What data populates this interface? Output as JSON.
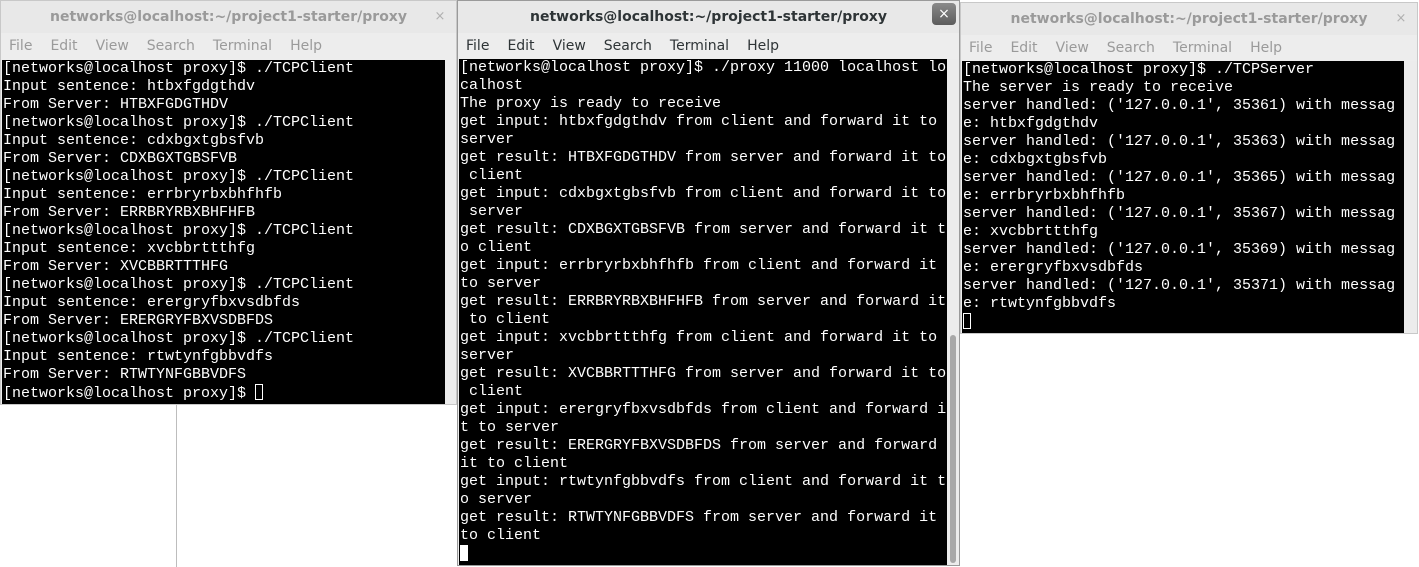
{
  "windows": {
    "client": {
      "title": "networks@localhost:~/project1-starter/proxy",
      "menu": [
        "File",
        "Edit",
        "View",
        "Search",
        "Terminal",
        "Help"
      ],
      "lines": [
        "[networks@localhost proxy]$ ./TCPClient",
        "Input sentence: htbxfgdgthdv",
        "From Server: HTBXFGDGTHDV",
        "[networks@localhost proxy]$ ./TCPClient",
        "Input sentence: cdxbgxtgbsfvb",
        "From Server: CDXBGXTGBSFVB",
        "[networks@localhost proxy]$ ./TCPClient",
        "Input sentence: errbryrbxbhfhfb",
        "From Server: ERRBRYRBXBHFHFB",
        "[networks@localhost proxy]$ ./TCPClient",
        "Input sentence: xvcbbrttthfg",
        "From Server: XVCBBRTTTHFG",
        "[networks@localhost proxy]$ ./TCPClient",
        "Input sentence: erergryfbxvsdbfds",
        "From Server: ERERGRYFBXVSDBFDS",
        "[networks@localhost proxy]$ ./TCPClient",
        "Input sentence: rtwtynfgbbvdfs",
        "From Server: RTWTYNFGBBVDFS"
      ],
      "prompt": "[networks@localhost proxy]$ "
    },
    "proxy": {
      "title": "networks@localhost:~/project1-starter/proxy",
      "menu": [
        "File",
        "Edit",
        "View",
        "Search",
        "Terminal",
        "Help"
      ],
      "lines": [
        "[networks@localhost proxy]$ ./proxy 11000 localhost lo",
        "calhost",
        "The proxy is ready to receive",
        "get input: htbxfgdgthdv from client and forward it to",
        "server",
        "get result: HTBXFGDGTHDV from server and forward it to",
        " client",
        "get input: cdxbgxtgbsfvb from client and forward it to",
        " server",
        "get result: CDXBGXTGBSFVB from server and forward it t",
        "o client",
        "get input: errbryrbxbhfhfb from client and forward it",
        "to server",
        "get result: ERRBRYRBXBHFHFB from server and forward it",
        " to client",
        "get input: xvcbbrttthfg from client and forward it to",
        "server",
        "get result: XVCBBRTTTHFG from server and forward it to",
        " client",
        "get input: erergryfbxvsdbfds from client and forward i",
        "t to server",
        "get result: ERERGRYFBXVSDBFDS from server and forward",
        "it to client",
        "get input: rtwtynfgbbvdfs from client and forward it t",
        "o server",
        "get result: RTWTYNFGBBVDFS from server and forward it",
        "to client"
      ]
    },
    "server": {
      "title": "networks@localhost:~/project1-starter/proxy",
      "menu": [
        "File",
        "Edit",
        "View",
        "Search",
        "Terminal",
        "Help"
      ],
      "lines": [
        "[networks@localhost proxy]$ ./TCPServer",
        "The server is ready to receive",
        "server handled: ('127.0.0.1', 35361) with messag",
        "e: htbxfgdgthdv",
        "server handled: ('127.0.0.1', 35363) with messag",
        "e: cdxbgxtgbsfvb",
        "server handled: ('127.0.0.1', 35365) with messag",
        "e: errbryrbxbhfhfb",
        "server handled: ('127.0.0.1', 35367) with messag",
        "e: xvcbbrttthfg",
        "server handled: ('127.0.0.1', 35369) with messag",
        "e: erergryfbxvsdbfds",
        "server handled: ('127.0.0.1', 35371) with messag",
        "e: rtwtynfgbbvdfs"
      ]
    }
  },
  "icons": {
    "close": "×"
  },
  "colors": {
    "terminal_bg": "#000000",
    "terminal_fg": "#ffffff",
    "titlebar_bg": "#e8e8e8",
    "inactive_text": "#9a9a9a",
    "active_text": "#2e3436"
  }
}
